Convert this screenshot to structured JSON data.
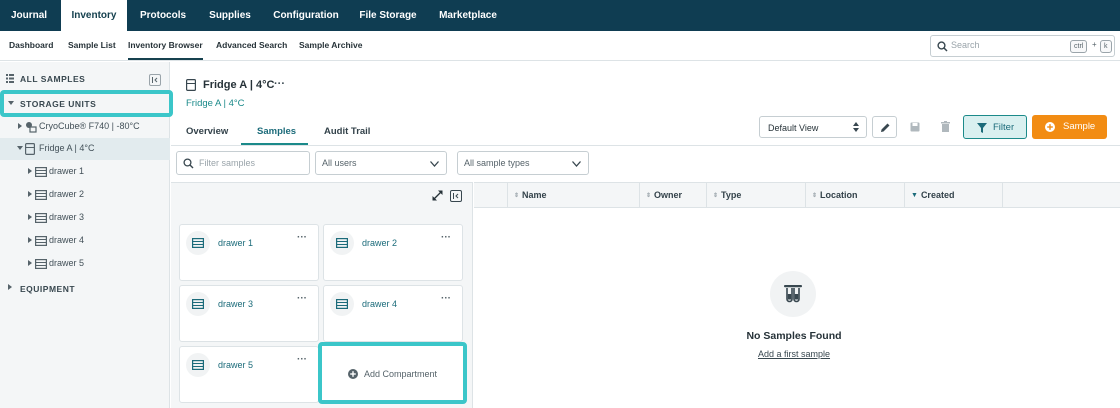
{
  "top_nav": {
    "tabs": [
      "Journal",
      "Inventory",
      "Protocols",
      "Supplies",
      "Configuration",
      "File Storage",
      "Marketplace"
    ],
    "active": "Inventory"
  },
  "sub_nav": {
    "items": [
      "Dashboard",
      "Sample List",
      "Inventory Browser",
      "Advanced Search",
      "Sample Archive"
    ],
    "active": "Inventory Browser"
  },
  "search": {
    "placeholder": "Search",
    "shortcut_key1": "ctrl",
    "shortcut_plus": "+",
    "shortcut_key2": "k"
  },
  "sidebar": {
    "all_samples": "ALL SAMPLES",
    "storage_units": "STORAGE UNITS",
    "equipment": "EQUIPMENT",
    "tree": {
      "cryocube": "CryoCube® F740 | -80°C",
      "fridge": "Fridge A | 4°C",
      "drawers": [
        "drawer 1",
        "drawer 2",
        "drawer 3",
        "drawer 4",
        "drawer 5"
      ]
    }
  },
  "header": {
    "title": "Fridge A | 4°C",
    "breadcrumb": "Fridge A | 4°C",
    "more": "···"
  },
  "tabs": {
    "items": [
      "Overview",
      "Samples",
      "Audit Trail"
    ],
    "active": "Samples"
  },
  "toolbar": {
    "view_select": "Default View",
    "filter_label": "Filter",
    "sample_label": "Sample"
  },
  "filters": {
    "search_placeholder": "Filter samples",
    "users": "All users",
    "types": "All sample types"
  },
  "compartments": {
    "items": [
      "drawer 1",
      "drawer 2",
      "drawer 3",
      "drawer 4",
      "drawer 5"
    ],
    "add_label": "Add Compartment",
    "more": "···"
  },
  "table": {
    "columns": [
      "Name",
      "Owner",
      "Type",
      "Location",
      "Created"
    ],
    "sorted_column": "Created"
  },
  "empty_state": {
    "title": "No Samples Found",
    "link": "Add a first sample"
  },
  "colors": {
    "nav_bg": "#0f3d52",
    "accent_teal": "#1b6b7a",
    "highlight": "#3bc6c9",
    "orange": "#f28c13"
  }
}
